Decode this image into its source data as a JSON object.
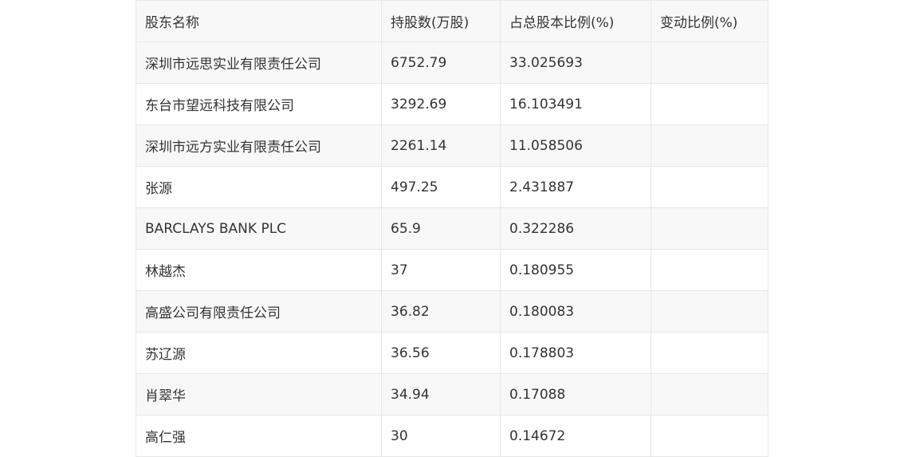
{
  "table": {
    "headers": [
      "股东名称",
      "持股数(万股)",
      "占总股本比例(%)",
      "变动比例(%)"
    ],
    "rows": [
      {
        "name": "深圳市远思实业有限责任公司",
        "shares": "6752.79",
        "ratio": "33.025693",
        "change": ""
      },
      {
        "name": "东台市望远科技有限公司",
        "shares": "3292.69",
        "ratio": "16.103491",
        "change": ""
      },
      {
        "name": "深圳市远方实业有限责任公司",
        "shares": "2261.14",
        "ratio": "11.058506",
        "change": ""
      },
      {
        "name": "张源",
        "shares": "497.25",
        "ratio": "2.431887",
        "change": ""
      },
      {
        "name": "BARCLAYS BANK PLC",
        "shares": "65.9",
        "ratio": "0.322286",
        "change": ""
      },
      {
        "name": "林越杰",
        "shares": "37",
        "ratio": "0.180955",
        "change": ""
      },
      {
        "name": "高盛公司有限责任公司",
        "shares": "36.82",
        "ratio": "0.180083",
        "change": ""
      },
      {
        "name": "苏辽源",
        "shares": "36.56",
        "ratio": "0.178803",
        "change": ""
      },
      {
        "name": "肖翠华",
        "shares": "34.94",
        "ratio": "0.17088",
        "change": ""
      },
      {
        "name": "高仁强",
        "shares": "30",
        "ratio": "0.14672",
        "change": ""
      }
    ]
  }
}
